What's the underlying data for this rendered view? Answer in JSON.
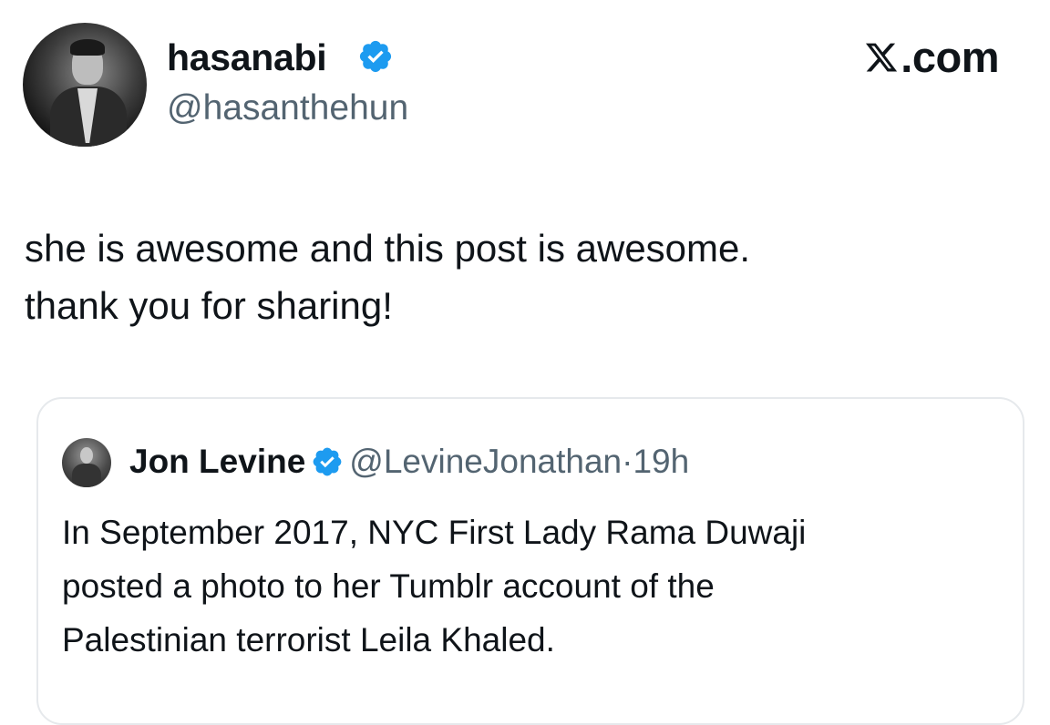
{
  "author": {
    "display_name": "hasanabi",
    "handle": "@hasanthehun",
    "verified_icon": "verified-badge-icon",
    "avatar": "profile-photo"
  },
  "brand": {
    "label": ".com",
    "icon": "x-logo-icon"
  },
  "tweet": {
    "text": "she is awesome and this post is awesome.\nthank you for sharing!"
  },
  "quoted": {
    "display_name": "Jon Levine",
    "handle": "@LevineJonathan",
    "separator": "·",
    "time": "19h",
    "verified_icon": "verified-badge-icon",
    "text": "In September 2017, NYC First Lady Rama Duwaji\nposted a photo to her Tumblr account of the\nPalestinian terrorist Leila Khaled."
  },
  "colors": {
    "verified_blue": "#1d9bf0",
    "text_primary": "#0f1419",
    "text_secondary": "#536471",
    "card_border": "#e6e9ec"
  }
}
